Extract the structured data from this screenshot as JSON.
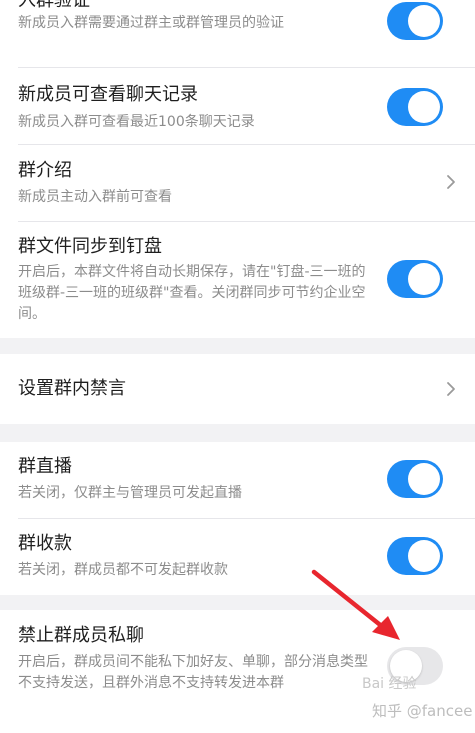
{
  "settings": {
    "join_verify": {
      "title": "入群验证",
      "desc": "新成员入群需要通过群主或群管理员的验证",
      "toggle_on": true
    },
    "view_history": {
      "title": "新成员可查看聊天记录",
      "desc": "新成员入群可查看最近100条聊天记录",
      "toggle_on": true
    },
    "group_intro": {
      "title": "群介绍",
      "desc": "新成员主动入群前可查看"
    },
    "file_sync": {
      "title": "群文件同步到钉盘",
      "desc": "开启后，本群文件将自动长期保存，请在\"钉盘-三一班的班级群-三一班的班级群\"查看。关闭群同步可节约企业空间。",
      "toggle_on": true
    },
    "mute": {
      "title": "设置群内禁言"
    },
    "live": {
      "title": "群直播",
      "desc": "若关闭，仅群主与管理员可发起直播",
      "toggle_on": true
    },
    "collect": {
      "title": "群收款",
      "desc": "若关闭，群成员都不可发起群收款",
      "toggle_on": true
    },
    "private_chat": {
      "title": "禁止群成员私聊",
      "desc": "开启后，群成员间不能私下加好友、单聊，部分消息类型不支持发送，且群外消息不支持转发进本群",
      "toggle_on": false
    }
  },
  "watermarks": {
    "zhihu": "知乎 @fancee",
    "baidu": "Bai 经验"
  },
  "colors": {
    "toggle_on": "#1f8cf4",
    "toggle_off": "#e7e7e9",
    "arrow": "#e8262e",
    "background": "#f2f2f4"
  }
}
